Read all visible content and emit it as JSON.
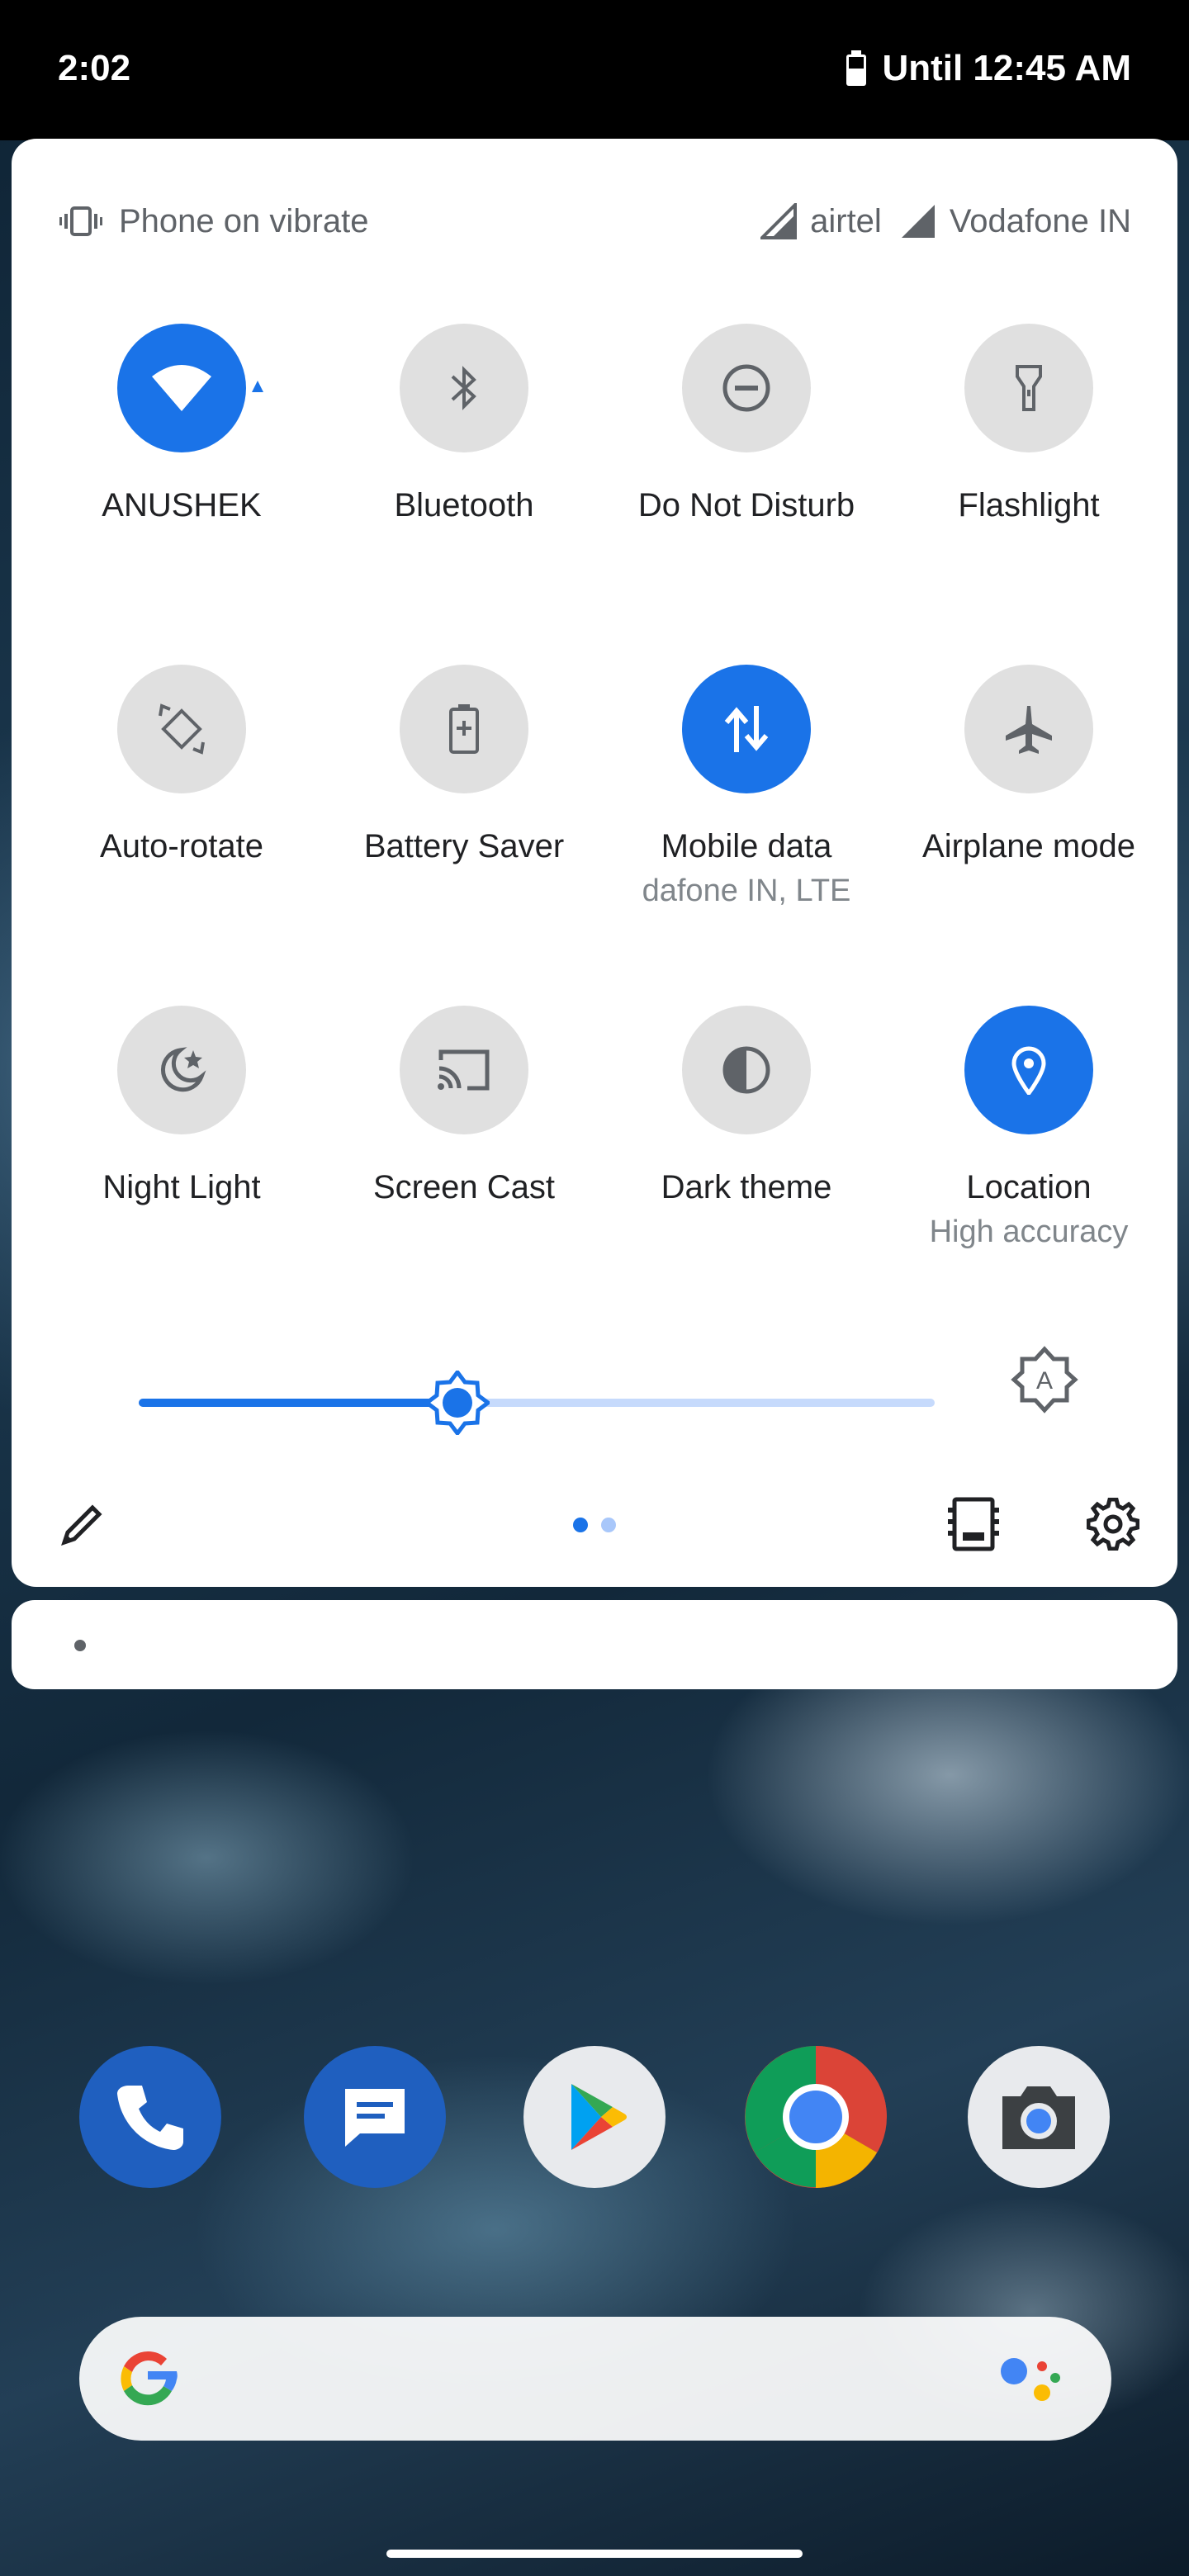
{
  "status_bar": {
    "time": "2:02",
    "battery_text": "Until 12:45 AM"
  },
  "qs_header": {
    "ringer_status": "Phone on vibrate",
    "carrier_1": "airtel",
    "carrier_2": "Vodafone IN"
  },
  "tiles": [
    {
      "label": "ANUSHEK",
      "icon": "wifi-icon",
      "active": true
    },
    {
      "label": "Bluetooth",
      "icon": "bluetooth-icon",
      "active": false
    },
    {
      "label": "Do Not Disturb",
      "icon": "do-not-disturb-icon",
      "active": false
    },
    {
      "label": "Flashlight",
      "icon": "flashlight-icon",
      "active": false
    },
    {
      "label": "Auto-rotate",
      "icon": "auto-rotate-icon",
      "active": false
    },
    {
      "label": "Battery Saver",
      "icon": "battery-saver-icon",
      "active": false
    },
    {
      "label": "Mobile data",
      "sublabel": "dafone IN, LTE",
      "icon": "mobile-data-icon",
      "active": true
    },
    {
      "label": "Airplane mode",
      "icon": "airplane-icon",
      "active": false
    },
    {
      "label": "Night Light",
      "icon": "night-light-icon",
      "active": false
    },
    {
      "label": "Screen Cast",
      "icon": "screen-cast-icon",
      "active": false
    },
    {
      "label": "Dark theme",
      "icon": "dark-theme-icon",
      "active": false
    },
    {
      "label": "Location",
      "sublabel": "High accuracy",
      "icon": "location-icon",
      "active": true
    }
  ],
  "brightness": {
    "level": 0.4
  },
  "pager": {
    "current_page": 1,
    "total_pages": 2
  },
  "dock": {
    "apps": [
      "phone-icon",
      "messages-icon",
      "play-store-icon",
      "chrome-icon",
      "camera-icon"
    ]
  },
  "colors": {
    "accent": "#1a73e8",
    "tile_off": "#e0e0e0",
    "text_primary": "#202124",
    "text_secondary": "#5f6368"
  }
}
